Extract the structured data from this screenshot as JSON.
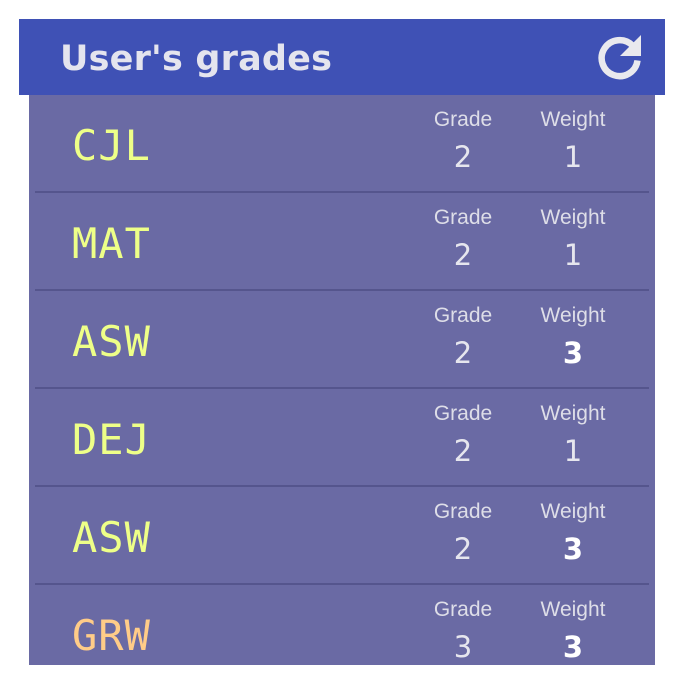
{
  "header": {
    "title": "User's grades",
    "refresh_icon": "refresh-icon"
  },
  "colors": {
    "header_bg": "#3f51b5",
    "list_bg": "#6a6aa4",
    "code_default": "#eeff88",
    "code_alt": "#ffcc88"
  },
  "grades": [
    {
      "code": "CJL",
      "grade_label": "Grade",
      "grade": "2",
      "weight_label": "Weight",
      "weight": "1",
      "weight_bold": false,
      "code_color": "#eeff88"
    },
    {
      "code": "MAT",
      "grade_label": "Grade",
      "grade": "2",
      "weight_label": "Weight",
      "weight": "1",
      "weight_bold": false,
      "code_color": "#eeff88"
    },
    {
      "code": "ASW",
      "grade_label": "Grade",
      "grade": "2",
      "weight_label": "Weight",
      "weight": "3",
      "weight_bold": true,
      "code_color": "#eeff88"
    },
    {
      "code": "DEJ",
      "grade_label": "Grade",
      "grade": "2",
      "weight_label": "Weight",
      "weight": "1",
      "weight_bold": false,
      "code_color": "#eeff88"
    },
    {
      "code": "ASW",
      "grade_label": "Grade",
      "grade": "2",
      "weight_label": "Weight",
      "weight": "3",
      "weight_bold": true,
      "code_color": "#eeff88"
    },
    {
      "code": "GRW",
      "grade_label": "Grade",
      "grade": "3",
      "weight_label": "Weight",
      "weight": "3",
      "weight_bold": true,
      "code_color": "#ffcc88"
    }
  ]
}
